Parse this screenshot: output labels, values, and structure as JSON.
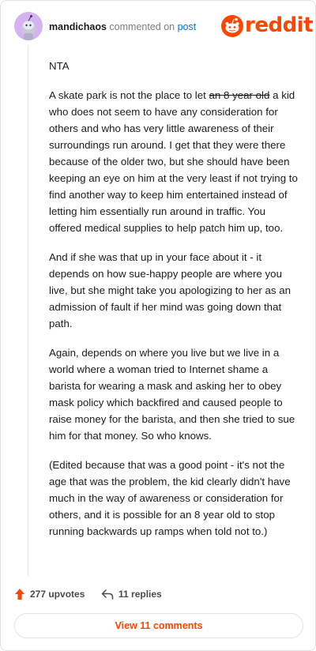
{
  "comment": {
    "username": "mandichaos",
    "action_text": "commented on",
    "post_link": "post",
    "brand": "reddit",
    "paragraphs": {
      "p1": "NTA",
      "p2_before": "A skate park is not the place to let ",
      "p2_strike": "an 8 year old",
      "p2_after": " a kid who does not seem to have any consideration for others and who has very little awareness of their surroundings run around. I get that they were there because of the older two, but she should have been keeping an eye on him at the very least if not trying to find another way to keep him entertained instead of letting him essentially run around in traffic. You offered medical supplies to help patch him up, too.",
      "p3": "And if she was that up in your face about it - it depends on how sue-happy people are where you live, but she might take you apologizing to her as an admission of fault if her mind was going down that path.",
      "p4": "Again, depends on where you live but we live in a world where a woman tried to Internet shame a barista for wearing a mask and asking her to obey mask policy which backfired and caused people to raise money for the barista, and then she tried to sue him for that money. So who knows.",
      "p5": "(Edited because that was a good point - it's not the age that was the problem, the kid clearly didn't have much in the way of awareness or consideration for others, and it is possible for an 8 year old to stop running backwards up ramps when told not to.)"
    },
    "upvotes_label": "277 upvotes",
    "replies_label": "11 replies",
    "view_comments_label": "View 11 comments"
  },
  "colors": {
    "brand": "#ff4500",
    "link": "#0079d3",
    "avatar_bg": "#d4b3f0"
  },
  "icons": [
    "snoo-avatar-icon",
    "reddit-logo-icon",
    "upvote-arrow-icon",
    "reply-arrow-icon"
  ]
}
